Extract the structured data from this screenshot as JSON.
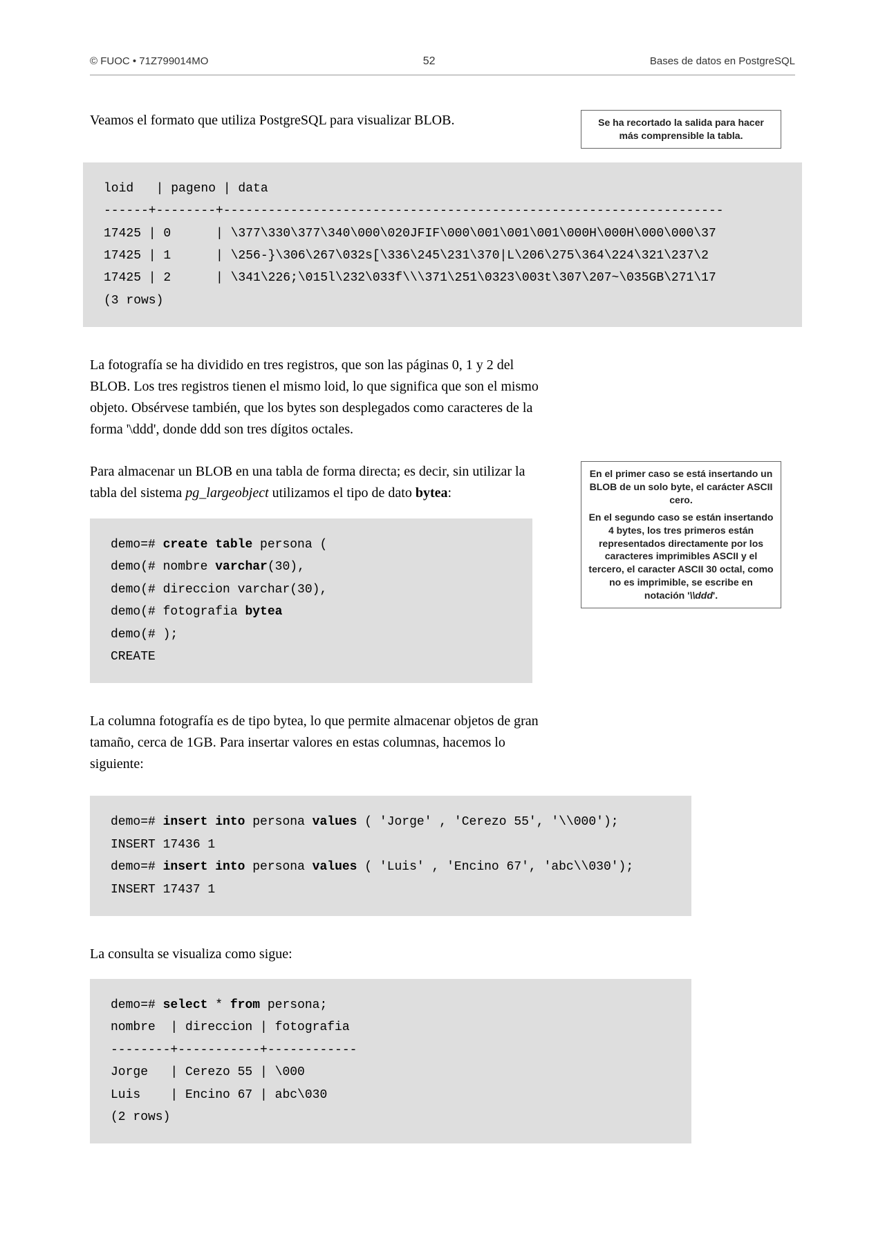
{
  "header": {
    "copyright": "© FUOC • 71Z799014MO",
    "page_number": "52",
    "title_right": "Bases de datos en PostgreSQL"
  },
  "intro_para": "Veamos el formato que utiliza PostgreSQL para visualizar BLOB.",
  "side_note_1": "Se ha recortado la salida para hacer más comprensible la tabla.",
  "code_block_1": {
    "line1": "loid   | pageno | data",
    "line2": "------+--------+-------------------------------------------------------------------",
    "line3": "17425 | 0      | \\377\\330\\377\\340\\000\\020JFIF\\000\\001\\001\\001\\000H\\000H\\000\\000\\37",
    "line4": "17425 | 1      | \\256-}\\306\\267\\032s[\\336\\245\\231\\370|L\\206\\275\\364\\224\\321\\237\\2",
    "line5": "17425 | 2      | \\341\\226;\\015l\\232\\033f\\\\\\371\\251\\0323\\003t\\307\\207~\\035GB\\271\\17",
    "line6": "(3 rows)"
  },
  "para_2": {
    "text_a": "La fotografía se ha dividido en tres registros, que son las páginas 0, 1 y 2 del BLOB. Los tres registros tienen el mismo ",
    "italic_a": "loid",
    "text_b": ", lo que significa que son el mismo objeto. Obsérvese también, que los bytes son desplegados como caracteres de la forma '",
    "italic_b": "\\ddd",
    "text_c": "', donde ddd son tres dígitos octales."
  },
  "para_3": {
    "text_a": "Para almacenar un BLOB en una tabla de forma directa; es decir, sin utilizar la tabla del sistema ",
    "italic_a": "pg_largeobject",
    "text_b": " utilizamos el tipo de dato ",
    "bold_a": "bytea",
    "text_c": ":"
  },
  "side_note_2": {
    "p1": "En el primer caso se está insertando un BLOB de un solo byte, el carácter ASCII cero.",
    "p2_a": "En el segundo caso se están insertando 4 bytes, los tres primeros están representados directamente por los caracteres imprimibles ASCII y el tercero, el caracter ASCII 30 octal, como no es imprimible, se escribe en notación '",
    "p2_italic": "\\\\ddd",
    "p2_b": "'."
  },
  "code_block_2": {
    "prefix1": "demo=# ",
    "bold1": "create table",
    "rest1": " persona (",
    "prefix2": "demo(# nombre ",
    "bold2": "varchar",
    "rest2": "(30),",
    "line3": "demo(# direccion varchar(30),",
    "prefix4": "demo(# fotografia ",
    "bold4": "bytea",
    "line5": "demo(# );",
    "line6": "CREATE"
  },
  "para_4": {
    "text_a": "La columna fotografía es de tipo ",
    "bold_a": "bytea",
    "text_b": ", lo que permite almacenar objetos de gran tamaño, cerca de 1GB. Para insertar valores en estas columnas, hacemos lo siguiente:"
  },
  "code_block_3": {
    "p1a": "demo=# ",
    "b1": "insert into",
    "p1b": " persona ",
    "b2": "values",
    "p1c": " ( 'Jorge' , 'Cerezo 55', '\\\\000');",
    "line2": "INSERT 17436 1",
    "p3a": "demo=# ",
    "b3": "insert into",
    "p3b": " persona ",
    "b4": "values",
    "p3c": " ( 'Luis' , 'Encino 67', 'abc\\\\030');",
    "line4": "INSERT 17437 1"
  },
  "para_5": "La consulta se visualiza como sigue:",
  "code_block_4": {
    "p1a": "demo=# ",
    "b1": "select",
    "p1b": " * ",
    "b2": "from",
    "p1c": " persona;",
    "line2": "nombre  | direccion | fotografia",
    "line3": "--------+-----------+------------",
    "line4": "Jorge   | Cerezo 55 | \\000",
    "line5": "Luis    | Encino 67 | abc\\030",
    "line6": "(2 rows)"
  }
}
